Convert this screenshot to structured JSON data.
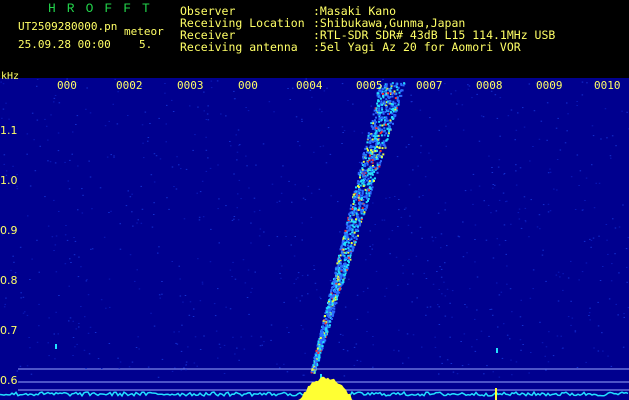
{
  "header": {
    "app_title": "HROFFT",
    "filename": "UT2509280000.pn",
    "mode": "meteor",
    "date_time": "25.09.28 00:00",
    "scale_value": "5."
  },
  "metadata": [
    {
      "label": "Observer",
      "value": ":Masaki Kano"
    },
    {
      "label": "Receiving Location",
      "value": ":Shibukawa,Gunma,Japan"
    },
    {
      "label": "Receiver",
      "value": ":RTL-SDR SDR# 43dB L15 114.1MHz USB"
    },
    {
      "label": "Receiving antenna",
      "value": ":5el Yagi Az 20 for Aomori VOR"
    }
  ],
  "axis": {
    "unit": "kHz",
    "y_ticks": [
      "1.1",
      "1.0",
      "0.9",
      "0.8",
      "0.7",
      "0.6"
    ],
    "x_ticks": [
      "000",
      "0002",
      "0003",
      "000",
      "0004",
      "0005",
      "0007",
      "0008",
      "0009",
      "0010"
    ]
  },
  "colors": {
    "background": "#00008f",
    "text": "#ffff66",
    "title": "#22d24a",
    "signal_low": "#2a6cff",
    "signal_mid": "#22e0ff",
    "signal_high": "#ff3030",
    "baseline": "#ffff33"
  }
}
